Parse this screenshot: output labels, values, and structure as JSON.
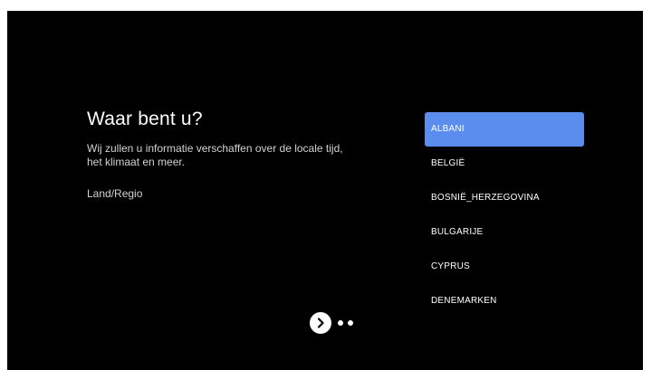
{
  "setup": {
    "title": "Waar bent u?",
    "description_lines": [
      "Wij zullen u informatie verschaffen over de locale tijd,",
      "het klimaat en meer."
    ],
    "field_label": "Land/Regio"
  },
  "countries": {
    "selected_index": 0,
    "items": [
      {
        "label": "ALBANI"
      },
      {
        "label": "BELGIË"
      },
      {
        "label": "BOSNIË_HERZEGOVINA"
      },
      {
        "label": "BULGARIJE"
      },
      {
        "label": "CYPRUS"
      },
      {
        "label": "DENEMARKEN"
      }
    ]
  },
  "pager": {
    "next_icon": "chevron-right-icon",
    "dot_count": 2
  },
  "colors": {
    "background": "#000000",
    "accent": "#5b8def",
    "text_primary": "#ffffff",
    "text_secondary": "#d2d2d2"
  }
}
